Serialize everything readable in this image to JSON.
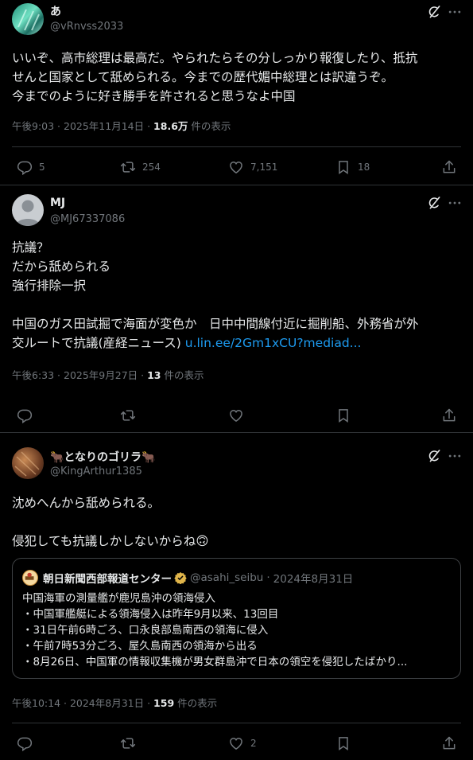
{
  "posts": [
    {
      "name": "あ",
      "handle": "@vRnvss2033",
      "lines": [
        "いいぞ、高市総理は最高だ。やられたらその分しっかり報復したり、抵抗",
        "せんと国家として舐められる。今までの歴代媚中総理とは訳違うぞ。",
        "今までのように好き勝手を許されると思うなよ中国"
      ],
      "time": "午後9:03 · 2025年11月14日 · ",
      "views": "18.6万",
      "views_suffix": " 件の表示",
      "replies": "5",
      "reposts": "254",
      "likes": "7,151",
      "bookmarks": "18"
    },
    {
      "name": "MJ",
      "handle": "@MJ67337086",
      "lines": [
        "抗議？",
        "だから舐められる",
        "強行排除一択",
        "",
        "中国のガス田試掘で海面が変色か　日中中間線付近に掘削船、外務省が外"
      ],
      "last_line": "交ルートで抗議(産経ニュース) ",
      "link": "u.lin.ee/2Gm1xCU?mediad...",
      "time": "午後6:33 · 2025年9月27日 · ",
      "views": "13",
      "views_suffix": " 件の表示"
    },
    {
      "name": "🐂となりのゴリラ🐂",
      "handle": "@KingArthur1385",
      "lines": [
        "沈めへんから舐められる。",
        "",
        "侵犯しても抗議しかしないからね🙃"
      ],
      "quote": {
        "name": "朝日新聞西部報道センター",
        "handle": "@asahi_seibu",
        "date": "2024年8月31日",
        "lines": [
          "中国海軍の測量艦が鹿児島沖の領海侵入",
          "・中国軍艦艇による領海侵入は昨年9月以来、13回目",
          "・31日午前6時ごろ、口永良部島南西の領海に侵入",
          "・午前7時53分ごろ、屋久島南西の領海から出る",
          "・8月26日、中国軍の情報収集機が男女群島沖で日本の領空を侵犯したばかり..."
        ]
      },
      "time": "午後10:14 · 2024年8月31日 · ",
      "views": "159",
      "views_suffix": " 件の表示",
      "likes": "2"
    }
  ],
  "icons": {
    "grok": "grok-icon",
    "more": "more-icon",
    "reply": "reply-icon",
    "repost": "repost-icon",
    "like": "like-icon",
    "bookmark": "bookmark-icon",
    "share": "share-icon"
  },
  "colors": {
    "background": "#000000",
    "text": "#e7e9ea",
    "muted": "#71767b",
    "link": "#1d9bf0",
    "divider": "#2f3336",
    "verified": "#e0b54a"
  }
}
